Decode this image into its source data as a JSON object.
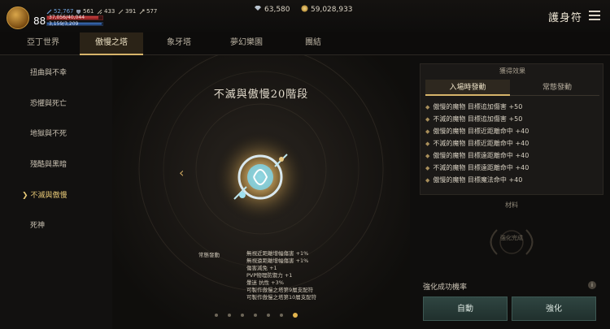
{
  "player": {
    "level": "88",
    "stats": [
      {
        "icon": "sword-icon",
        "value": "52,767"
      },
      {
        "icon": "shield-icon",
        "value": "561"
      },
      {
        "icon": "blade-icon",
        "value": "433"
      },
      {
        "icon": "slash-icon",
        "value": "391"
      },
      {
        "icon": "arrow-icon",
        "value": "577"
      }
    ],
    "hp_text": "37,056/40,044",
    "hp_fraction": 0.925,
    "mp_text": "3,159/3,209",
    "mp_fraction": 0.984
  },
  "currency": {
    "gems": "63,580",
    "gold": "59,028,933"
  },
  "header": {
    "title": "護身符"
  },
  "tabs": [
    {
      "label": "亞丁世界",
      "active": false
    },
    {
      "label": "傲慢之塔",
      "active": true
    },
    {
      "label": "象牙塔",
      "active": false
    },
    {
      "label": "夢幻樂園",
      "active": false
    },
    {
      "label": "團結",
      "active": false
    }
  ],
  "sidebar": {
    "items": [
      {
        "label": "扭曲與不幸"
      },
      {
        "label": "恐懼與死亡"
      },
      {
        "label": "地獄與不死"
      },
      {
        "label": "殘酷與黑暗"
      },
      {
        "label": "不滅與傲慢",
        "active": true
      },
      {
        "label": "死神"
      }
    ]
  },
  "stage": {
    "title": "不滅與傲慢20階段",
    "effects_label": "常態發動",
    "effects": [
      "無視近距離增幅傷害 +1%",
      "無視遠距離增幅傷害 +1%",
      "傷害減免 +1",
      "PVP物理防禦力 +1",
      "暈迷 抗性 +3%",
      "可製作傲慢之塔第9層支配符",
      "可製作傲慢之塔第10層支配符"
    ],
    "page_count": 7,
    "active_page": 7
  },
  "effects_panel": {
    "title": "獲得效果",
    "tabs": [
      {
        "label": "入場時發動",
        "active": true
      },
      {
        "label": "常態發動",
        "active": false
      }
    ],
    "buffs": [
      "傲慢的魔物 目標追加傷害 +50",
      "不滅的魔物 目標追加傷害 +50",
      "傲慢的魔物 目標近距離命中 +40",
      "不滅的魔物 目標近距離命中 +40",
      "傲慢的魔物 目標遠距離命中 +40",
      "不滅的魔物 目標遠距離命中 +40",
      "傲慢的魔物 目標魔法命中 +40"
    ],
    "materials_label": "材料",
    "enhance_done": "強化完成"
  },
  "enhance": {
    "rate_label": "強化成功機率",
    "info_glyph": "i",
    "auto_label": "自動",
    "enhance_label": "強化"
  }
}
